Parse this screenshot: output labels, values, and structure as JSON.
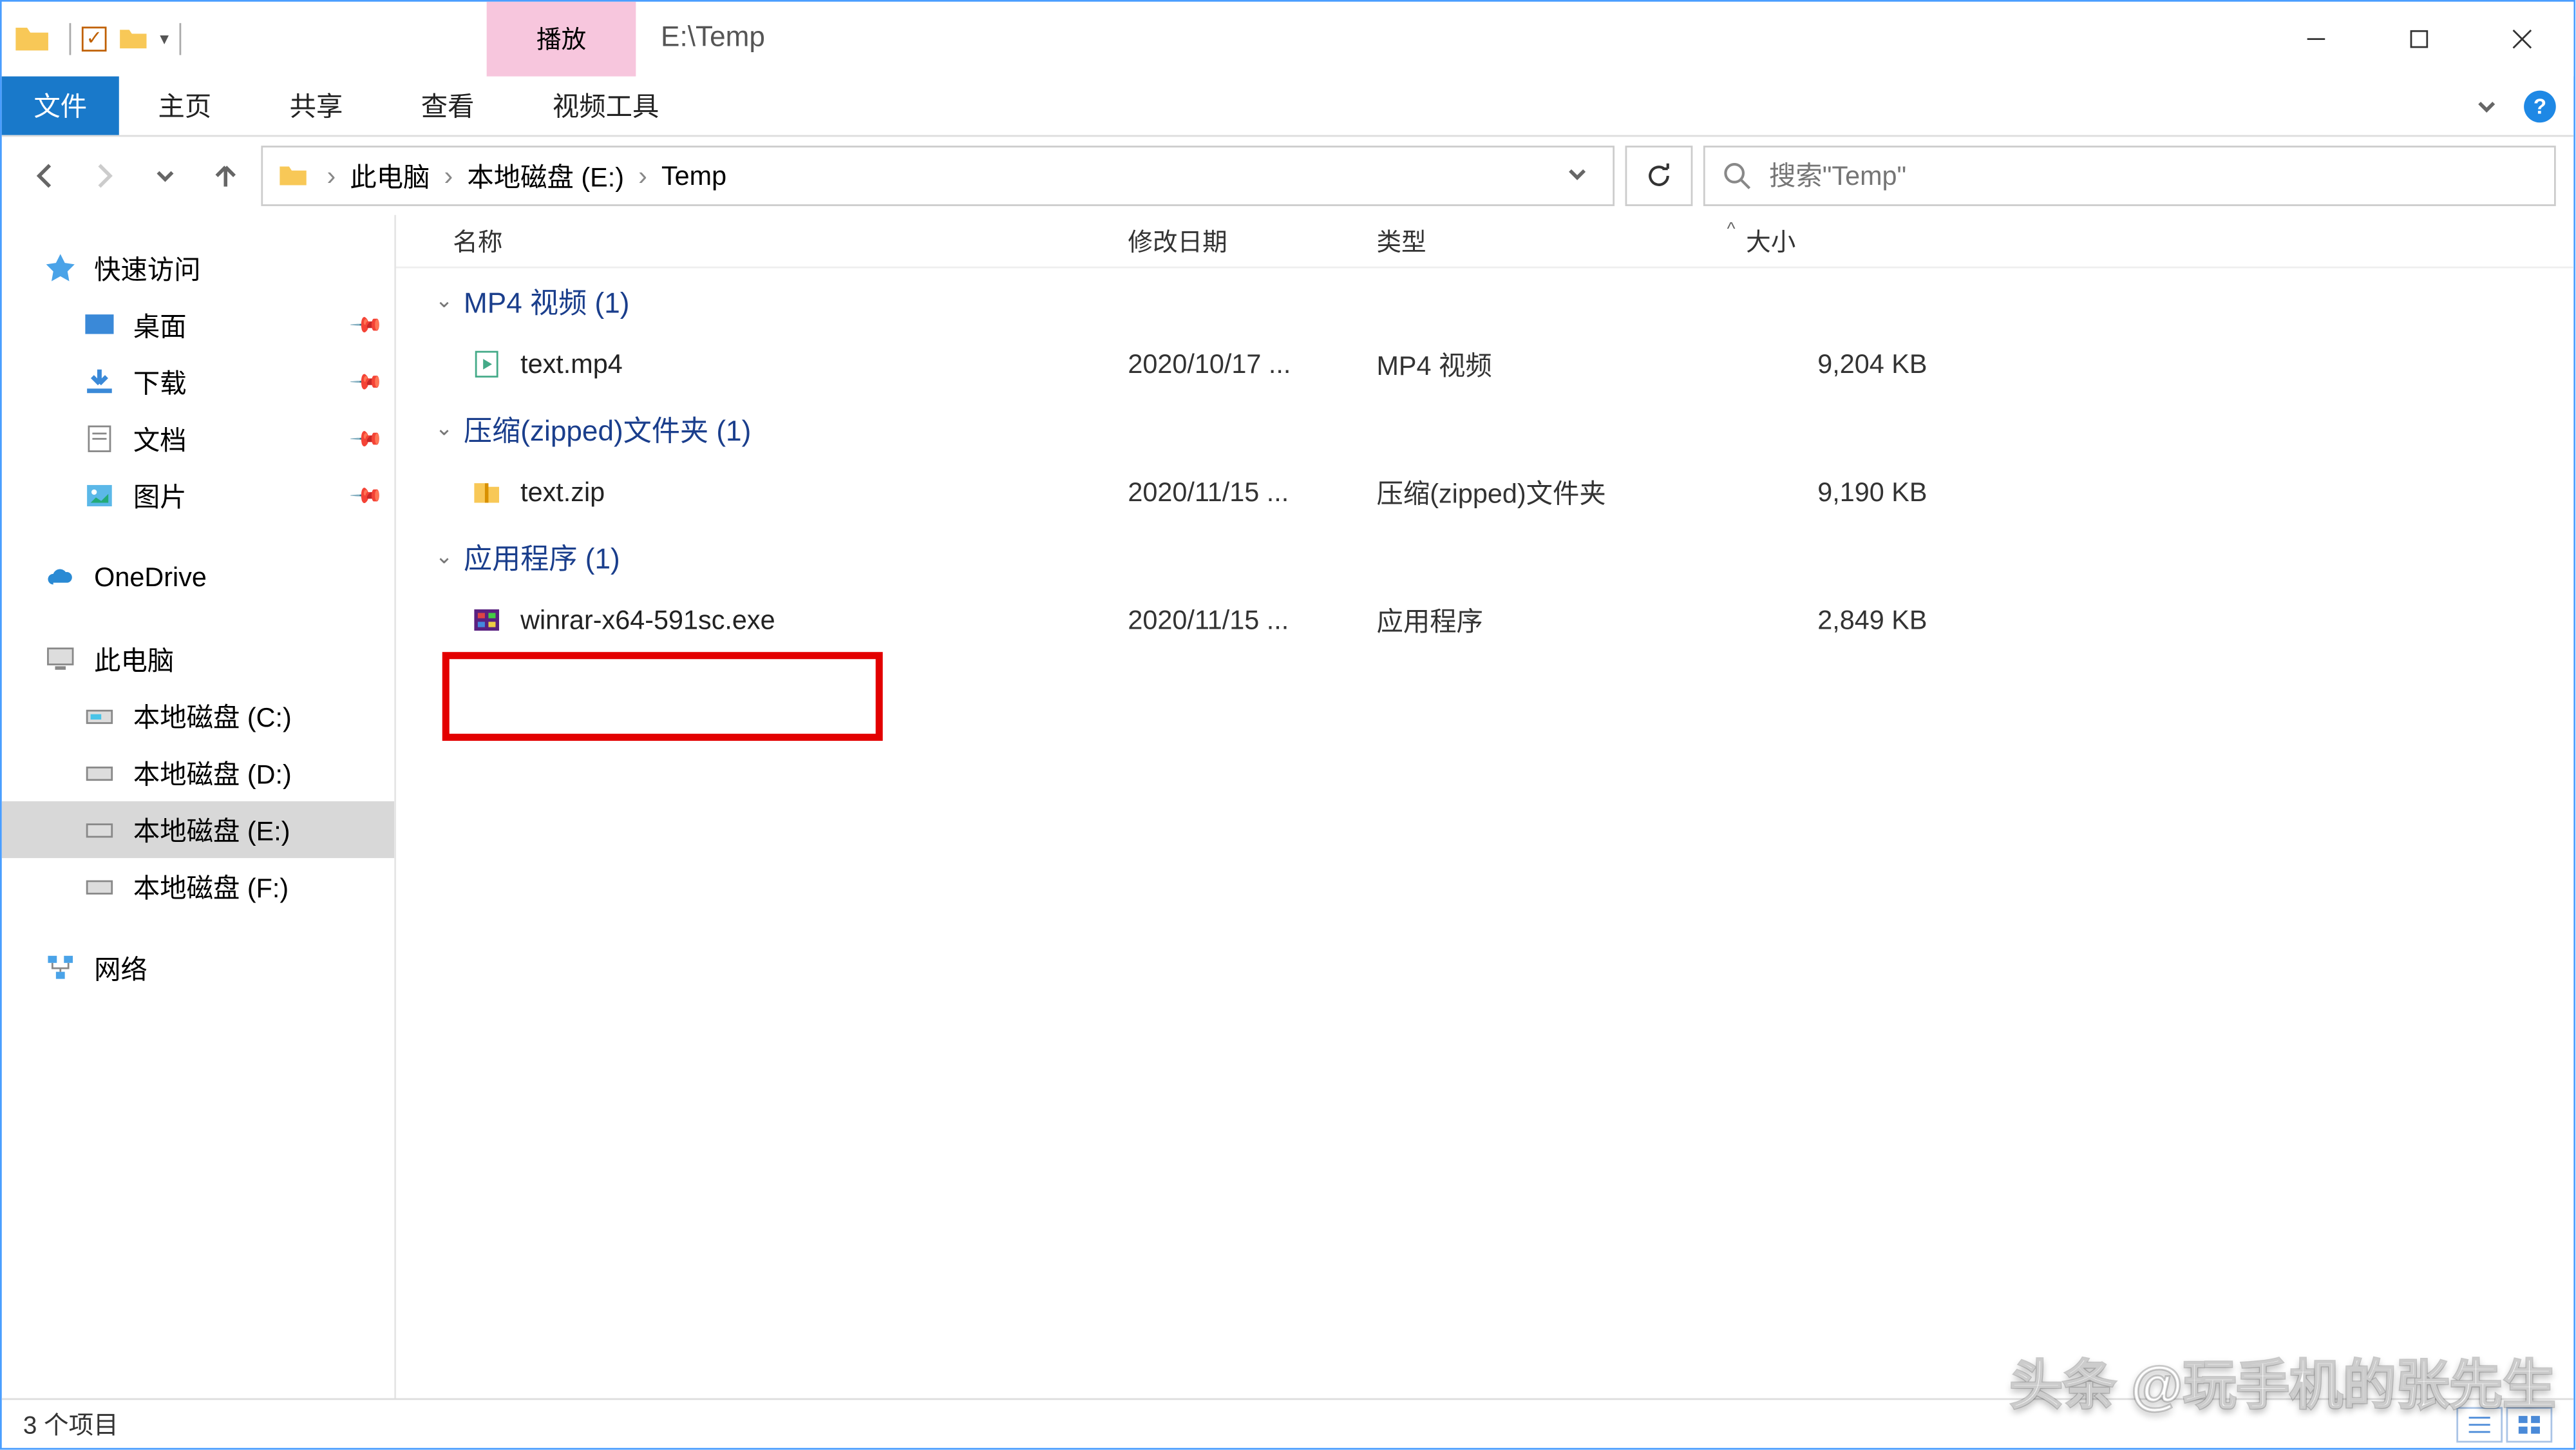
{
  "titlebar": {
    "play_tab": "播放",
    "path_title": "E:\\Temp"
  },
  "ribbon": {
    "file": "文件",
    "home": "主页",
    "share": "共享",
    "view": "查看",
    "video_tools": "视频工具"
  },
  "address": {
    "crumbs": [
      "此电脑",
      "本地磁盘 (E:)",
      "Temp"
    ]
  },
  "search": {
    "placeholder": "搜索\"Temp\""
  },
  "sidebar": {
    "quick_access": "快速访问",
    "desktop": "桌面",
    "downloads": "下载",
    "documents": "文档",
    "pictures": "图片",
    "onedrive": "OneDrive",
    "this_pc": "此电脑",
    "drive_c": "本地磁盘 (C:)",
    "drive_d": "本地磁盘 (D:)",
    "drive_e": "本地磁盘 (E:)",
    "drive_f": "本地磁盘 (F:)",
    "network": "网络"
  },
  "columns": {
    "name": "名称",
    "date": "修改日期",
    "type": "类型",
    "size": "大小"
  },
  "groups": [
    {
      "label": "MP4 视频 (1)",
      "items": [
        {
          "name": "text.mp4",
          "date": "2020/10/17 ...",
          "type": "MP4 视频",
          "size": "9,204 KB",
          "icon": "video"
        }
      ]
    },
    {
      "label": "压缩(zipped)文件夹 (1)",
      "items": [
        {
          "name": "text.zip",
          "date": "2020/11/15 ...",
          "type": "压缩(zipped)文件夹",
          "size": "9,190 KB",
          "icon": "zip"
        }
      ]
    },
    {
      "label": "应用程序 (1)",
      "items": [
        {
          "name": "winrar-x64-591sc.exe",
          "date": "2020/11/15 ...",
          "type": "应用程序",
          "size": "2,849 KB",
          "icon": "exe",
          "highlighted": true
        }
      ]
    }
  ],
  "status": {
    "count": "3 个项目"
  },
  "watermark": "头条 @玩手机的张先生"
}
